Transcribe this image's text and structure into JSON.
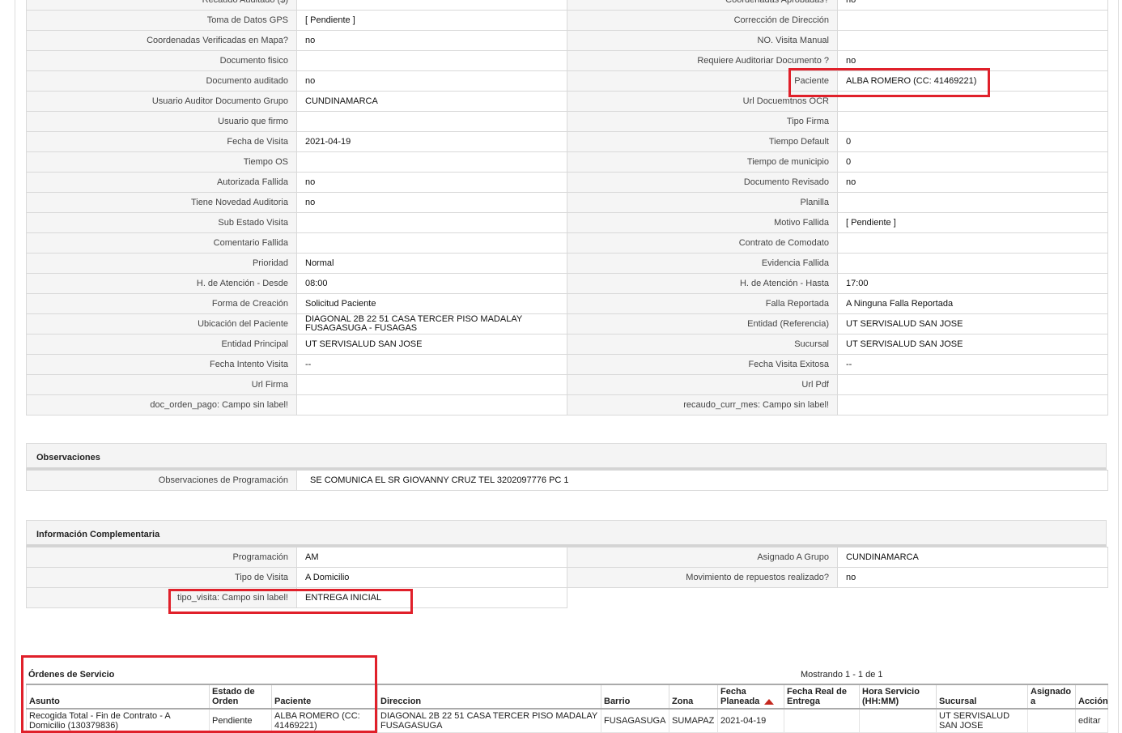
{
  "details": [
    {
      "l1": "Recaudo Auditado ($)",
      "v1": "",
      "l2": "Coordenadas Aprobadas?",
      "v2": "no"
    },
    {
      "l1": "Toma de Datos GPS",
      "v1": "[ Pendiente ]",
      "l2": "Corrección de Dirección",
      "v2": ""
    },
    {
      "l1": "Coordenadas Verificadas en Mapa?",
      "v1": "no",
      "l2": "NO. Visita Manual",
      "v2": ""
    },
    {
      "l1": "Documento fisico",
      "v1": "",
      "l2": "Requiere Auditoriar Documento ?",
      "v2": "no"
    },
    {
      "l1": "Documento auditado",
      "v1": "no",
      "l2": "Paciente",
      "v2": "ALBA ROMERO (CC: 41469221)"
    },
    {
      "l1": "Usuario Auditor Documento Grupo",
      "v1": "CUNDINAMARCA",
      "l2": "Url Docuemtnos OCR",
      "v2": ""
    },
    {
      "l1": "Usuario que firmo",
      "v1": "",
      "l2": "Tipo Firma",
      "v2": ""
    },
    {
      "l1": "Fecha de Visita",
      "v1": "2021-04-19",
      "l2": "Tiempo Default",
      "v2": "0"
    },
    {
      "l1": "Tiempo OS",
      "v1": "",
      "l2": "Tiempo de municipio",
      "v2": "0"
    },
    {
      "l1": "Autorizada Fallida",
      "v1": "no",
      "l2": "Documento Revisado",
      "v2": "no"
    },
    {
      "l1": "Tiene Novedad Auditoria",
      "v1": "no",
      "l2": "Planilla",
      "v2": ""
    },
    {
      "l1": "Sub Estado Visita",
      "v1": "",
      "l2": "Motivo Fallida",
      "v2": "[ Pendiente ]"
    },
    {
      "l1": "Comentario Fallida",
      "v1": "",
      "l2": "Contrato de Comodato",
      "v2": ""
    },
    {
      "l1": "Prioridad",
      "v1": "Normal",
      "l2": "Evidencia Fallida",
      "v2": ""
    },
    {
      "l1": "H. de Atención - Desde",
      "v1": "08:00",
      "l2": "H. de Atención - Hasta",
      "v2": "17:00"
    },
    {
      "l1": "Forma de Creación",
      "v1": "Solicitud Paciente",
      "l2": "Falla Reportada",
      "v2": "A Ninguna Falla Reportada"
    },
    {
      "l1": "Ubicación del Paciente",
      "v1": "DIAGONAL 2B 22 51 CASA TERCER PISO MADALAY FUSAGASUGA - FUSAGAS",
      "l2": "Entidad (Referencia)",
      "v2": "UT SERVISALUD SAN JOSE"
    },
    {
      "l1": "Entidad Principal",
      "v1": "UT SERVISALUD SAN JOSE",
      "l2": "Sucursal",
      "v2": "UT SERVISALUD SAN JOSE"
    },
    {
      "l1": "Fecha Intento Visita",
      "v1": "--",
      "l2": "Fecha Visita Exitosa",
      "v2": "--"
    },
    {
      "l1": "Url Firma",
      "v1": "",
      "l2": "Url Pdf",
      "v2": ""
    },
    {
      "l1": "doc_orden_pago: Campo sin label!",
      "v1": "",
      "l2": "recaudo_curr_mes: Campo sin label!",
      "v2": ""
    }
  ],
  "observaciones": {
    "title": "Observaciones",
    "label": "Observaciones de Programación",
    "value": "SE COMUNICA EL SR GIOVANNY CRUZ TEL 3202097776 PC 1"
  },
  "complementaria": {
    "title": "Información Complementaria",
    "rows": [
      {
        "l1": "Programación",
        "v1": "AM",
        "l2": "Asignado A Grupo",
        "v2": "CUNDINAMARCA"
      },
      {
        "l1": "Tipo de Visita",
        "v1": "A Domicilio",
        "l2": "Movimiento de repuestos realizado?",
        "v2": "no"
      },
      {
        "l1": "tipo_visita: Campo sin label!",
        "v1": "ENTREGA INICIAL"
      }
    ]
  },
  "orders": {
    "title": "Órdenes de Servicio",
    "showing": "Mostrando 1 - 1 de 1",
    "headers": [
      "Asunto",
      "Estado de Orden",
      "Paciente",
      "Direccion",
      "Barrio",
      "Zona",
      "Fecha Planeada",
      "Fecha Real de Entrega",
      "Hora Servicio (HH:MM)",
      "Sucursal",
      "Asignado a",
      "Acción"
    ],
    "row": {
      "asunto": "Recogida Total - Fin de Contrato - A Domicilio (130379836)",
      "estado": "Pendiente",
      "paciente": "ALBA ROMERO (CC: 41469221)",
      "direccion": "DIAGONAL 2B 22 51 CASA TERCER PISO MADALAY FUSAGASUGA",
      "barrio": "FUSAGASUGA",
      "zona": "SUMAPAZ",
      "fecha_planeada": "2021-04-19",
      "fecha_real": "",
      "hora": "",
      "sucursal": "UT SERVISALUD SAN JOSE",
      "asignado": "",
      "accion": "editar"
    }
  },
  "colors": {
    "highlight": "#e0202a",
    "sort_arrow": "#c4261d"
  }
}
